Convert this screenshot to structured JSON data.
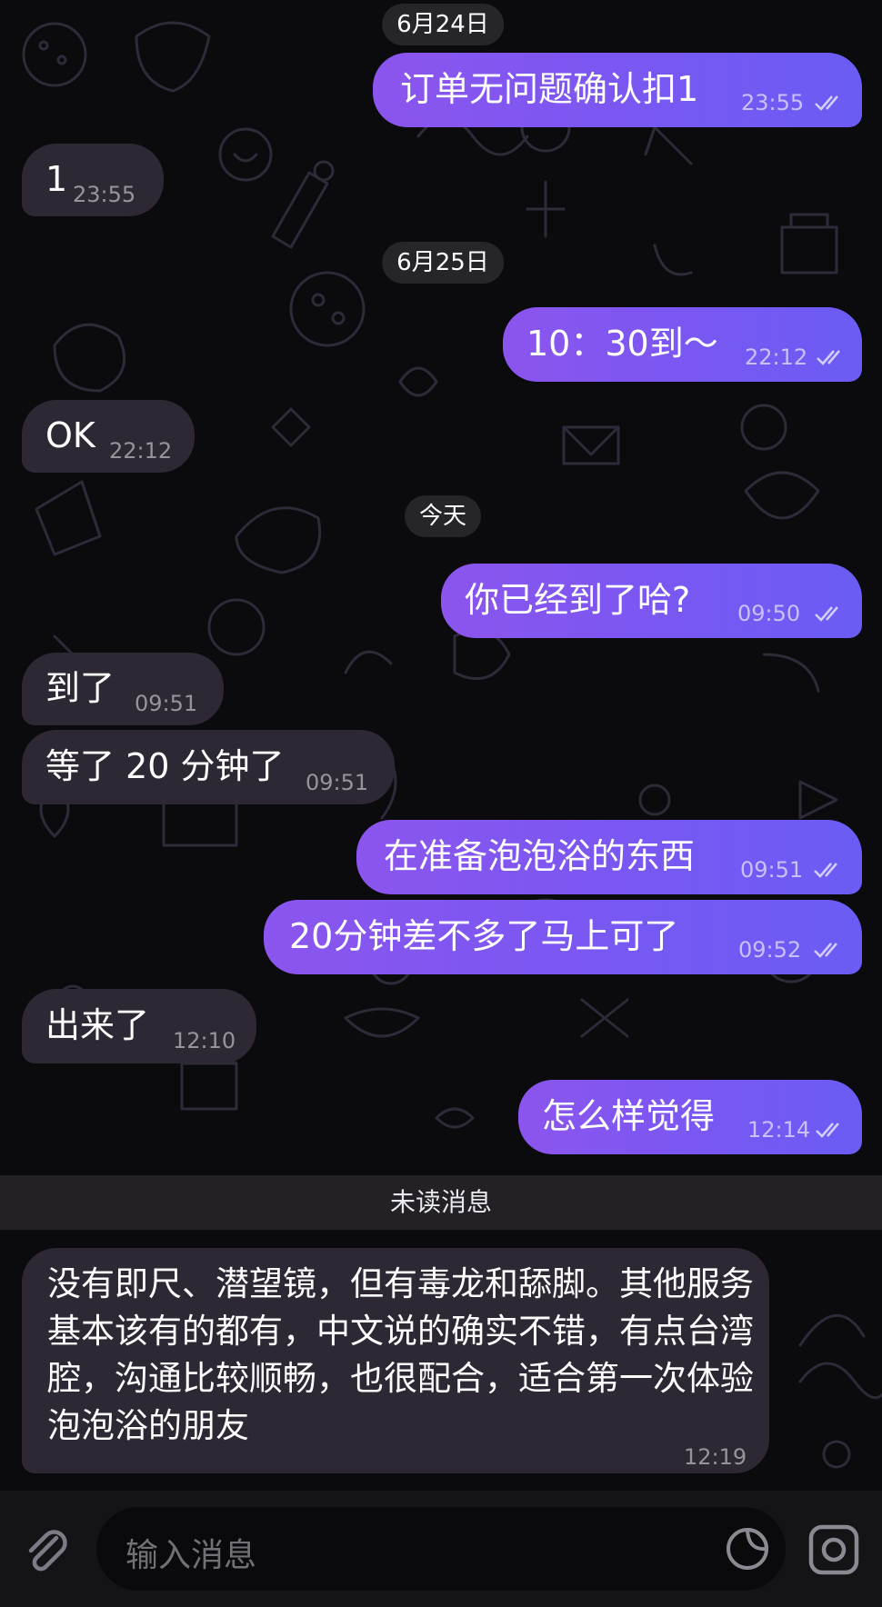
{
  "dates": [
    "6月24日",
    "6月25日",
    "今天"
  ],
  "messages": [
    {
      "text": "订单无问题确认扣1",
      "time": "23:55"
    },
    {
      "text": "1",
      "time": "23:55"
    },
    {
      "text": "10：30到～",
      "time": "22:12"
    },
    {
      "text": "OK",
      "time": "22:12"
    },
    {
      "text": "你已经到了哈?",
      "time": "09:50"
    },
    {
      "text": "到了",
      "time": "09:51"
    },
    {
      "text": "等了 20 分钟了",
      "time": "09:51"
    },
    {
      "text": "在准备泡泡浴的东西",
      "time": "09:51"
    },
    {
      "text": "20分钟差不多了马上可了",
      "time": "09:52"
    },
    {
      "text": "出来了",
      "time": "12:10"
    },
    {
      "text": "怎么样觉得",
      "time": "12:14"
    },
    {
      "text": "没有即尺、潜望镜，但有毒龙和舔脚。其他服务基本该有的都有，中文说的确实不错，有点台湾腔，沟通比较顺畅，也很配合，适合第一次体验泡泡浴的朋友",
      "time": "12:19"
    }
  ],
  "unread_label": "未读消息",
  "input": {
    "placeholder": "输入消息"
  },
  "icons": {
    "attach": "paperclip-icon",
    "sticker": "sticker-icon",
    "camera": "camera-icon",
    "read_receipt": "double-check-icon"
  },
  "colors": {
    "outgoing_start": "#8b55ee",
    "outgoing_end": "#6a5cf4",
    "incoming": "#2d2833",
    "background": "#0b0a0d"
  }
}
